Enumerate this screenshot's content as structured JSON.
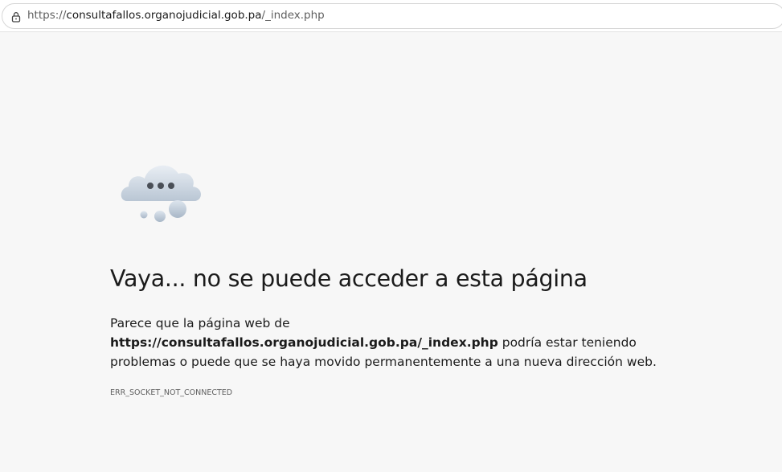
{
  "browser": {
    "url": "https://consultafallos.organojudicial.gob.pa/_index.php",
    "url_host": "consultafallos.organojudicial.gob.pa",
    "url_path": "/_index.php",
    "url_scheme": "https://",
    "lock_icon": "lock-icon"
  },
  "error": {
    "icon": "cloud-thinking-icon",
    "title": "Vaya... no se puede acceder a esta página",
    "message_prefix": "Parece que la página web de ",
    "message_url": "https://consultafallos.organojudicial.gob.pa/_index.php",
    "message_suffix": " podría estar teniendo problemas o puede que se haya movido permanentemente a una nueva dirección web.",
    "code": "ERR_SOCKET_NOT_CONNECTED"
  }
}
